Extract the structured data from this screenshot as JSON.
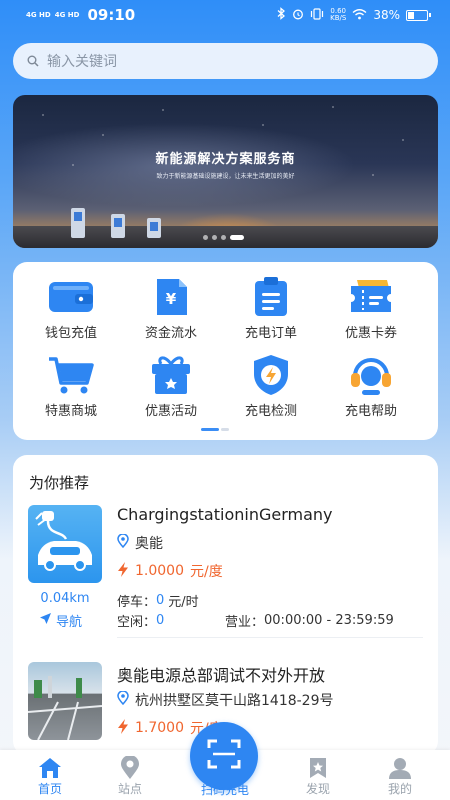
{
  "status": {
    "net1": "4G HD",
    "net2": "4G HD",
    "time": "09:10",
    "speed_value": "0.60",
    "speed_unit": "KB/S",
    "battery_text": "38%",
    "battery_level": 0.38
  },
  "search": {
    "placeholder": "输入关键词"
  },
  "banner": {
    "title": "新能源解决方案服务商",
    "subtitle": "致力于新能源基础设施建设，让未来生活更加的美好"
  },
  "menu": {
    "items": [
      {
        "label": "钱包充值",
        "icon": "wallet-icon"
      },
      {
        "label": "资金流水",
        "icon": "yuan-bill-icon"
      },
      {
        "label": "充电订单",
        "icon": "clipboard-icon"
      },
      {
        "label": "优惠卡券",
        "icon": "ticket-icon"
      },
      {
        "label": "特惠商城",
        "icon": "cart-icon"
      },
      {
        "label": "优惠活动",
        "icon": "gift-icon"
      },
      {
        "label": "充电检测",
        "icon": "shield-bolt-icon"
      },
      {
        "label": "充电帮助",
        "icon": "headset-icon"
      }
    ]
  },
  "recommend": {
    "title": "为你推荐",
    "stations": [
      {
        "name": "ChargingstationinGermany",
        "address": "奥能",
        "price": "1.0000",
        "price_unit": "元/度",
        "distance": "0.04km",
        "nav_label": "导航",
        "parking_label": "停车：",
        "parking_value": "0",
        "parking_unit": "元/时",
        "idle_label": "空闲：",
        "idle_value": "0",
        "hours_label": "营业：",
        "hours_value": "00:00:00 - 23:59:59"
      },
      {
        "name": "奥能电源总部调试不对外开放",
        "address": "杭州拱墅区莫干山路1418-29号",
        "price": "1.7000",
        "price_unit": "元/度"
      }
    ]
  },
  "tabbar": {
    "home": "首页",
    "stations": "站点",
    "scan": "扫码充电",
    "discover": "发现",
    "mine": "我的"
  },
  "colors": {
    "primary": "#2e86f2",
    "price": "#f0662f"
  }
}
